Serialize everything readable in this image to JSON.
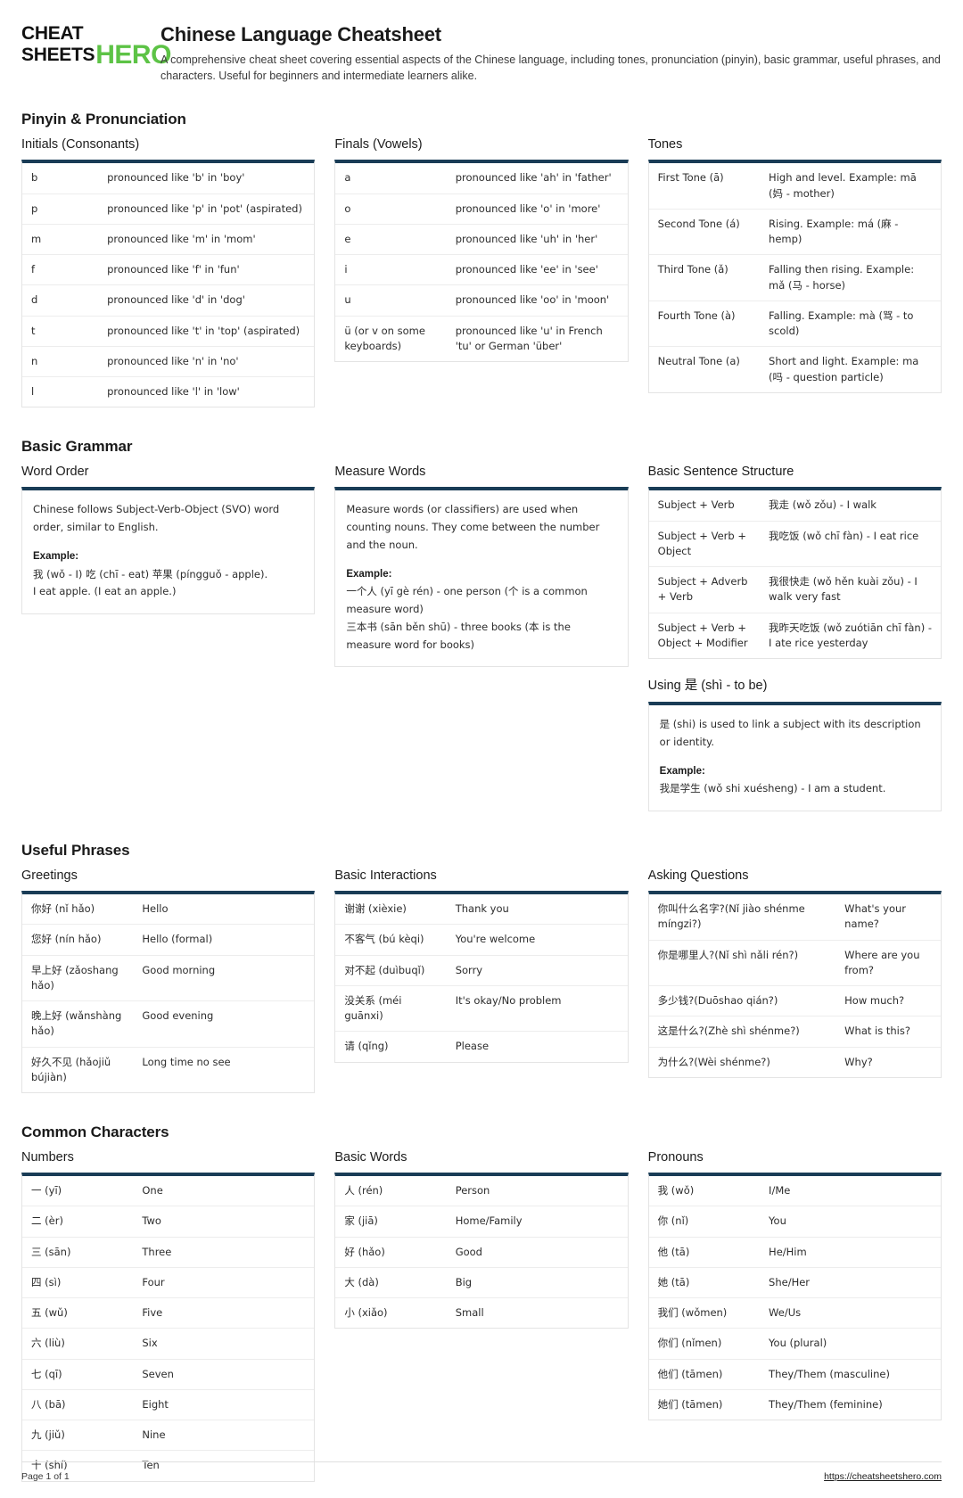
{
  "brand": {
    "word1": "CHEAT",
    "word2": "SHEETS",
    "hero": "HERO",
    "green": "#5dc346"
  },
  "header": {
    "title": "Chinese Language Cheatsheet",
    "description": "A comprehensive cheat sheet covering essential aspects of the Chinese language, including tones, pronunciation (pinyin), basic grammar, useful phrases, and characters. Useful for beginners and intermediate learners alike."
  },
  "theme": {
    "accent": "#193c56",
    "rule": "#ededed",
    "border": "#e4e4e4"
  },
  "sections": [
    {
      "title": "Pinyin & Pronunciation",
      "cards": [
        {
          "title": "Initials (Consonants)",
          "rows": [
            {
              "k": "b",
              "v": "pronounced like 'b' in 'boy'"
            },
            {
              "k": "p",
              "v": "pronounced like 'p' in 'pot' (aspirated)"
            },
            {
              "k": "m",
              "v": "pronounced like 'm' in 'mom'"
            },
            {
              "k": "f",
              "v": "pronounced like 'f' in 'fun'"
            },
            {
              "k": "d",
              "v": "pronounced like 'd' in 'dog'"
            },
            {
              "k": "t",
              "v": "pronounced like 't' in 'top' (aspirated)"
            },
            {
              "k": "n",
              "v": "pronounced like 'n' in 'no'"
            },
            {
              "k": "l",
              "v": "pronounced like 'l' in 'low'"
            }
          ]
        },
        {
          "title": "Finals (Vowels)",
          "rows": [
            {
              "k": "a",
              "v": "pronounced like 'ah' in 'father'"
            },
            {
              "k": "o",
              "v": "pronounced like 'o' in 'more'"
            },
            {
              "k": "e",
              "v": "pronounced like 'uh' in 'her'"
            },
            {
              "k": "i",
              "v": "pronounced like 'ee' in 'see'"
            },
            {
              "k": "u",
              "v": "pronounced like 'oo' in 'moon'"
            },
            {
              "k": "ü (or v on some keyboards)",
              "v": "pronounced like 'u' in French 'tu' or German 'über'"
            }
          ]
        },
        {
          "title": "Tones",
          "rows": [
            {
              "k": "First Tone (ā)",
              "v": "High and level. Example: mā (妈 - mother)"
            },
            {
              "k": "Second Tone (á)",
              "v": "Rising. Example: má (麻 - hemp)"
            },
            {
              "k": "Third Tone (ǎ)",
              "v": "Falling then rising. Example: mǎ (马 - horse)"
            },
            {
              "k": "Fourth Tone (à)",
              "v": "Falling. Example: mà (骂 - to scold)"
            },
            {
              "k": "Neutral Tone (a)",
              "v": "Short and light. Example: ma (吗 - question particle)"
            }
          ]
        }
      ]
    },
    {
      "title": "Basic Grammar",
      "cards": [
        {
          "title": "Word Order",
          "prose": {
            "intro": "Chinese follows Subject-Verb-Object (SVO) word order, similar to English.",
            "example_label": "Example:",
            "example_lines": [
              "我 (wǒ - I) 吃 (chī - eat) 苹果 (píngguǒ - apple).",
              "I eat apple. (I eat an apple.)"
            ]
          }
        },
        {
          "title": "Measure Words",
          "prose": {
            "intro": "Measure words (or classifiers) are used when counting nouns. They come between the number and the noun.",
            "example_label": "Example:",
            "example_lines": [
              "一个人 (yī gè rén) - one person (个 is a common measure word)",
              "三本书 (sān běn shū) - three books (本 is the measure word for books)"
            ]
          }
        },
        {
          "title": "Basic Sentence Structure",
          "rows": [
            {
              "k": "Subject + Verb",
              "v": "我走 (wǒ zǒu) - I walk"
            },
            {
              "k": "Subject + Verb + Object",
              "v": "我吃饭 (wǒ chī fàn) - I eat rice"
            },
            {
              "k": "Subject + Adverb + Verb",
              "v": "我很快走 (wǒ hěn kuài zǒu) - I walk very fast"
            },
            {
              "k": "Subject + Verb + Object + Modifier",
              "v": "我昨天吃饭 (wǒ zuótiān chī fàn) - I ate rice yesterday"
            }
          ]
        },
        {
          "title": "Using 是 (shì - to be)",
          "prose": {
            "intro": "是 (shi) is used to link a subject with its description or identity.",
            "example_label": "Example:",
            "example_lines": [
              "我是学生 (wǒ shi xuésheng) - I am a student."
            ]
          }
        }
      ]
    },
    {
      "title": "Useful Phrases",
      "cards": [
        {
          "title": "Greetings",
          "rows": [
            {
              "k": "你好 (nǐ hǎo)",
              "v": "Hello"
            },
            {
              "k": "您好 (nín hǎo)",
              "v": "Hello (formal)"
            },
            {
              "k": "早上好 (zǎoshang hǎo)",
              "v": "Good morning"
            },
            {
              "k": "晚上好 (wǎnshàng hǎo)",
              "v": "Good evening"
            },
            {
              "k": "好久不见 (hǎojiǔ bújiàn)",
              "v": "Long time no see"
            }
          ]
        },
        {
          "title": "Basic Interactions",
          "rows": [
            {
              "k": "谢谢 (xièxie)",
              "v": "Thank you"
            },
            {
              "k": "不客气 (bú kèqi)",
              "v": "You're welcome"
            },
            {
              "k": "对不起 (duìbuqǐ)",
              "v": "Sorry"
            },
            {
              "k": "没关系 (méi guānxi)",
              "v": "It's okay/No problem"
            },
            {
              "k": "请 (qǐng)",
              "v": "Please"
            }
          ]
        },
        {
          "title": "Asking Questions",
          "rows": [
            {
              "k": "你叫什么名字?(Nǐ jiào shénme míngzi?)",
              "v": "What's your name?"
            },
            {
              "k": "你是哪里人?(Nǐ shì nǎli rén?)",
              "v": "Where are you from?"
            },
            {
              "k": "多少钱?(Duōshao qián?)",
              "v": "How much?"
            },
            {
              "k": "这是什么?(Zhè shì shénme?)",
              "v": "What is this?"
            },
            {
              "k": "为什么?(Wèi shénme?)",
              "v": "Why?"
            }
          ]
        }
      ]
    },
    {
      "title": "Common Characters",
      "cards": [
        {
          "title": "Numbers",
          "rows": [
            {
              "k": "一 (yī)",
              "v": "One"
            },
            {
              "k": "二 (èr)",
              "v": "Two"
            },
            {
              "k": "三 (sān)",
              "v": "Three"
            },
            {
              "k": "四 (sì)",
              "v": "Four"
            },
            {
              "k": "五 (wǔ)",
              "v": "Five"
            },
            {
              "k": "六 (liù)",
              "v": "Six"
            },
            {
              "k": "七 (qī)",
              "v": "Seven"
            },
            {
              "k": "八 (bā)",
              "v": "Eight"
            },
            {
              "k": "九 (jiǔ)",
              "v": "Nine"
            },
            {
              "k": "十 (shí)",
              "v": "Ten"
            }
          ]
        },
        {
          "title": "Basic Words",
          "rows": [
            {
              "k": "人 (rén)",
              "v": "Person"
            },
            {
              "k": "家 (jiā)",
              "v": "Home/Family"
            },
            {
              "k": "好 (hǎo)",
              "v": "Good"
            },
            {
              "k": "大 (dà)",
              "v": "Big"
            },
            {
              "k": "小 (xiǎo)",
              "v": "Small"
            }
          ]
        },
        {
          "title": "Pronouns",
          "rows": [
            {
              "k": "我 (wǒ)",
              "v": "I/Me"
            },
            {
              "k": "你 (nǐ)",
              "v": "You"
            },
            {
              "k": "他 (tā)",
              "v": "He/Him"
            },
            {
              "k": "她 (tā)",
              "v": "She/Her"
            },
            {
              "k": "我们 (wǒmen)",
              "v": "We/Us"
            },
            {
              "k": "你们 (nǐmen)",
              "v": "You (plural)"
            },
            {
              "k": "他们 (tāmen)",
              "v": "They/Them (masculine)"
            },
            {
              "k": "她们 (tāmen)",
              "v": "They/Them (feminine)"
            }
          ]
        }
      ]
    }
  ],
  "footer": {
    "page": "Page 1 of 1",
    "url": "https://cheatsheetshero.com"
  }
}
